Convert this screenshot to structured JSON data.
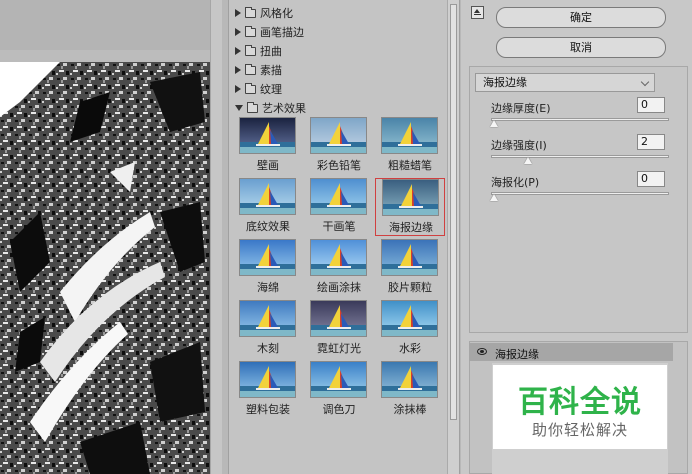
{
  "gallery": {
    "folders": [
      {
        "label": "风格化",
        "open": false
      },
      {
        "label": "画笔描边",
        "open": false
      },
      {
        "label": "扭曲",
        "open": false
      },
      {
        "label": "素描",
        "open": false
      },
      {
        "label": "纹理",
        "open": false
      },
      {
        "label": "艺术效果",
        "open": true
      }
    ],
    "filters": [
      {
        "label": "壁画"
      },
      {
        "label": "彩色铅笔"
      },
      {
        "label": "粗糙蜡笔"
      },
      {
        "label": "底纹效果"
      },
      {
        "label": "干画笔"
      },
      {
        "label": "海报边缘",
        "selected": true
      },
      {
        "label": "海绵"
      },
      {
        "label": "绘画涂抹"
      },
      {
        "label": "胶片颗粒"
      },
      {
        "label": "木刻"
      },
      {
        "label": "霓虹灯光"
      },
      {
        "label": "水彩"
      },
      {
        "label": "塑料包装"
      },
      {
        "label": "调色刀"
      },
      {
        "label": "涂抹棒"
      }
    ]
  },
  "panel": {
    "ok_label": "确定",
    "cancel_label": "取消",
    "filter_select": "海报边缘",
    "params": [
      {
        "label": "边缘厚度(E)",
        "value": "0",
        "fraction": 0.0
      },
      {
        "label": "边缘强度(I)",
        "value": "2",
        "fraction": 0.2
      },
      {
        "label": "海报化(P)",
        "value": "0",
        "fraction": 0.0
      }
    ],
    "layer_name": "海报边缘"
  },
  "watermark": {
    "title": "百科全说",
    "subtitle": "助你轻松解决"
  },
  "colors": {
    "watermark_green": "#2fb34a",
    "selection_red": "#d04040"
  }
}
